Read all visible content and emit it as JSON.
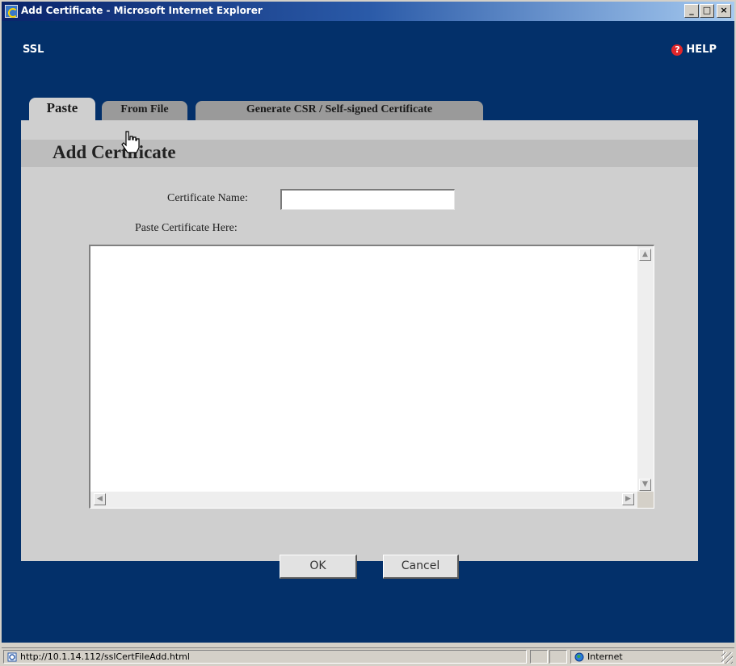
{
  "window": {
    "title": "Add Certificate - Microsoft Internet Explorer",
    "buttons": {
      "minimize": "_",
      "maximize": "□",
      "close": "×"
    }
  },
  "header": {
    "app_title": "SSL",
    "help_label": "HELP",
    "help_icon": "question-circle-icon"
  },
  "tabs": [
    {
      "label": "Paste",
      "active": true
    },
    {
      "label": "From File",
      "active": false
    },
    {
      "label": "Generate CSR / Self-signed Certificate",
      "active": false
    }
  ],
  "form": {
    "title": "Add Certificate",
    "cert_name_label": "Certificate Name:",
    "cert_name_value": "",
    "paste_label": "Paste Certificate Here:",
    "paste_value": "",
    "ok_label": "OK",
    "cancel_label": "Cancel"
  },
  "statusbar": {
    "url": "http://10.1.14.112/sslCertFileAdd.html",
    "zone": "Internet"
  },
  "colors": {
    "page_background": "#03306a",
    "panel_background": "#cfcfcf",
    "inactive_tab": "#9a9a9a",
    "help_icon": "#e0262a"
  }
}
